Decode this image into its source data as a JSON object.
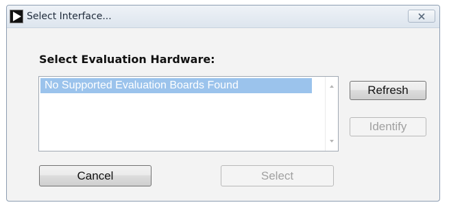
{
  "window": {
    "title": "Select Interface...",
    "close_icon": "close-icon",
    "app_icon": "play-triangle-icon"
  },
  "hardware": {
    "label": "Select Evaluation Hardware:",
    "items": [
      {
        "label": "No Supported Evaluation Boards Found",
        "selected": true
      }
    ]
  },
  "buttons": {
    "refresh": "Refresh",
    "identify": "Identify",
    "cancel": "Cancel",
    "select": "Select"
  },
  "colors": {
    "selection": "#9bc3ec",
    "disabled_text": "#a0a0a0"
  }
}
